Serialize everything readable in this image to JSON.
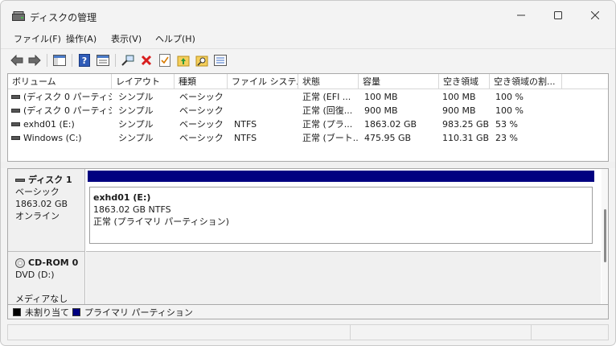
{
  "window": {
    "title": "ディスクの管理"
  },
  "menu": [
    {
      "label": "ファイル(F)"
    },
    {
      "label": "操作(A)"
    },
    {
      "label": "表示(V)"
    },
    {
      "label": "ヘルプ(H)"
    }
  ],
  "toolbar": {
    "icons": [
      "back-arrow-icon",
      "forward-arrow-icon",
      "console-tree-icon",
      "help-icon",
      "properties-icon",
      "connect-icon",
      "delete-icon",
      "check-icon",
      "folder-up-icon",
      "search-folder-icon",
      "list-icon"
    ]
  },
  "volume_table": {
    "columns": [
      "ボリューム",
      "レイアウト",
      "種類",
      "ファイル システム",
      "状態",
      "容量",
      "空き領域",
      "空き領域の割...",
      ""
    ],
    "rows": [
      {
        "volume": "(ディスク 0 パーティシ...",
        "layout": "シンプル",
        "type": "ベーシック",
        "fs": "",
        "status": "正常 (EFI ...",
        "capacity": "100 MB",
        "free": "100 MB",
        "pct": "100 %"
      },
      {
        "volume": "(ディスク 0 パーティシ...",
        "layout": "シンプル",
        "type": "ベーシック",
        "fs": "",
        "status": "正常 (回復...",
        "capacity": "900 MB",
        "free": "900 MB",
        "pct": "100 %"
      },
      {
        "volume": "exhd01 (E:)",
        "layout": "シンプル",
        "type": "ベーシック",
        "fs": "NTFS",
        "status": "正常 (プラ...",
        "capacity": "1863.02 GB",
        "free": "983.25 GB",
        "pct": "53 %"
      },
      {
        "volume": "Windows (C:)",
        "layout": "シンプル",
        "type": "ベーシック",
        "fs": "NTFS",
        "status": "正常 (ブート...",
        "capacity": "475.95 GB",
        "free": "110.31 GB",
        "pct": "23 %"
      }
    ]
  },
  "disks": [
    {
      "name": "ディスク 1",
      "kind": "ベーシック",
      "size": "1863.02 GB",
      "state": "オンライン",
      "partition": {
        "name": "exhd01  (E:)",
        "size_fs": "1863.02 GB NTFS",
        "status": "正常 (プライマリ パーティション)",
        "color": "#000080"
      }
    },
    {
      "name": "CD-ROM 0",
      "kind": "DVD (D:)",
      "blank": "",
      "state": "メディアなし"
    }
  ],
  "legend": [
    {
      "label": "未割り当て",
      "color": "#000000"
    },
    {
      "label": "プライマリ パーティション",
      "color": "#000080"
    }
  ]
}
